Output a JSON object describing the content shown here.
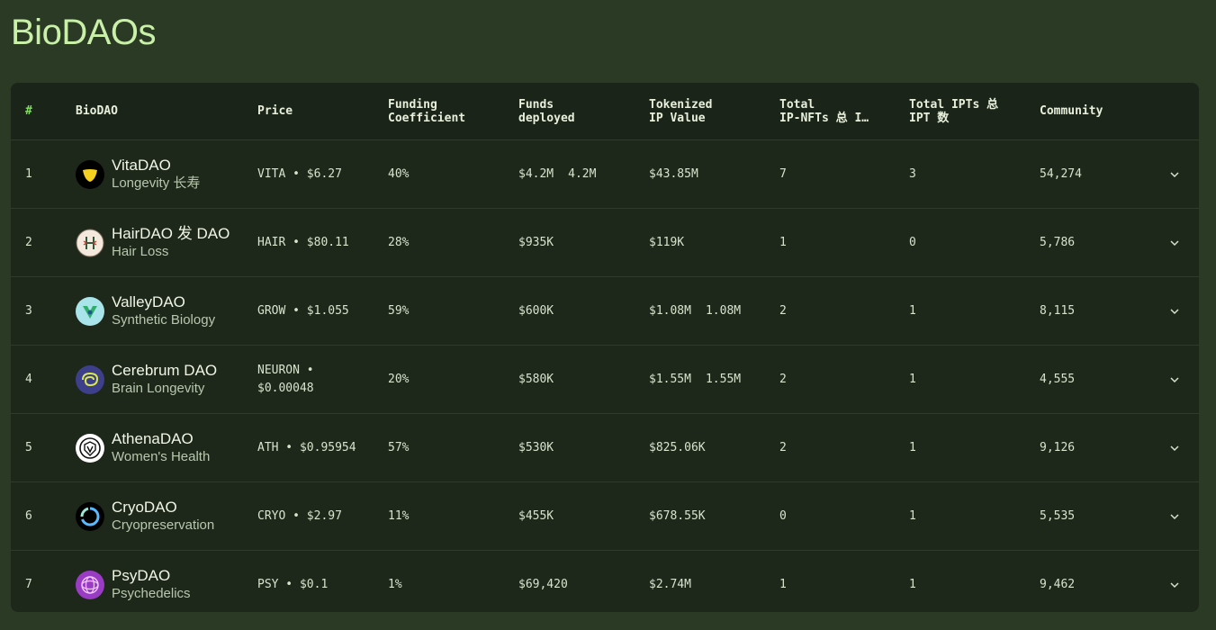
{
  "page": {
    "title": "BioDAOs"
  },
  "table": {
    "headers": {
      "index": "#",
      "biodao": "BioDAO",
      "price": "Price",
      "funding": "Funding\nCoefficient",
      "funds": "Funds\ndeployed",
      "tokenized": "Tokenized\nIP Value",
      "ipnfts": "Total\nIP-NFTs  总 I…",
      "ipts": "Total IPTs  总\nIPT 数",
      "community": "Community"
    },
    "rows": [
      {
        "index": "1",
        "name": "VitaDAO",
        "subtitle": "Longevity 长寿",
        "price": "VITA • $6.27",
        "funding": "40%",
        "funds": "$4.2M",
        "funds_extra": "4.2M",
        "tokenized": "$43.85M",
        "tokenized_extra": "",
        "ipnfts": "7",
        "ipts": "3",
        "community": "54,274",
        "logo_color": "#000000",
        "logo_accent": "#f5d020"
      },
      {
        "index": "2",
        "name": "HairDAO 发 DAO",
        "subtitle": "Hair Loss",
        "price": "HAIR • $80.11",
        "funding": "28%",
        "funds": "$935K",
        "funds_extra": "",
        "tokenized": "$119K",
        "tokenized_extra": "",
        "ipnfts": "1",
        "ipts": "0",
        "community": "5,786",
        "logo_color": "#f4e9dc",
        "logo_accent": "#2c5a3f"
      },
      {
        "index": "3",
        "name": "ValleyDAO",
        "subtitle": "Synthetic Biology",
        "price": "GROW • $1.055",
        "funding": "59%",
        "funds": "$600K",
        "funds_extra": "",
        "tokenized": "$1.08M",
        "tokenized_extra": "1.08M",
        "ipnfts": "2",
        "ipts": "1",
        "community": "8,115",
        "logo_color": "#a9e4ea",
        "logo_accent": "#2fae6b"
      },
      {
        "index": "4",
        "name": "Cerebrum DAO",
        "subtitle": "Brain Longevity",
        "price": "NEURON • $0.00048",
        "funding": "20%",
        "funds": "$580K",
        "funds_extra": "",
        "tokenized": "$1.55M",
        "tokenized_extra": "1.55M",
        "ipnfts": "2",
        "ipts": "1",
        "community": "4,555",
        "logo_color": "#3d3f8a",
        "logo_accent": "#d9e84a"
      },
      {
        "index": "5",
        "name": "AthenaDAO",
        "subtitle": "Women's Health",
        "price": "ATH • $0.95954",
        "funding": "57%",
        "funds": "$530K",
        "funds_extra": "",
        "tokenized": "$825.06K",
        "tokenized_extra": "",
        "ipnfts": "2",
        "ipts": "1",
        "community": "9,126",
        "logo_color": "#ffffff",
        "logo_accent": "#111111"
      },
      {
        "index": "6",
        "name": "CryoDAO",
        "subtitle": "Cryopreservation",
        "price": "CRYO • $2.97",
        "funding": "11%",
        "funds": "$455K",
        "funds_extra": "",
        "tokenized": "$678.55K",
        "tokenized_extra": "",
        "ipnfts": "0",
        "ipts": "1",
        "community": "5,535",
        "logo_color": "#000000",
        "logo_accent": "#5ab8ff"
      },
      {
        "index": "7",
        "name": "PsyDAO",
        "subtitle": "Psychedelics",
        "price": "PSY • $0.1",
        "funding": "1%",
        "funds": "$69,420",
        "funds_extra": "",
        "tokenized": "$2.74M",
        "tokenized_extra": "",
        "ipnfts": "1",
        "ipts": "1",
        "community": "9,462",
        "logo_color": "#9a3bc4",
        "logo_accent": "#f0c8ff"
      }
    ]
  },
  "icons": {
    "expand": "chevron-down-icon"
  }
}
